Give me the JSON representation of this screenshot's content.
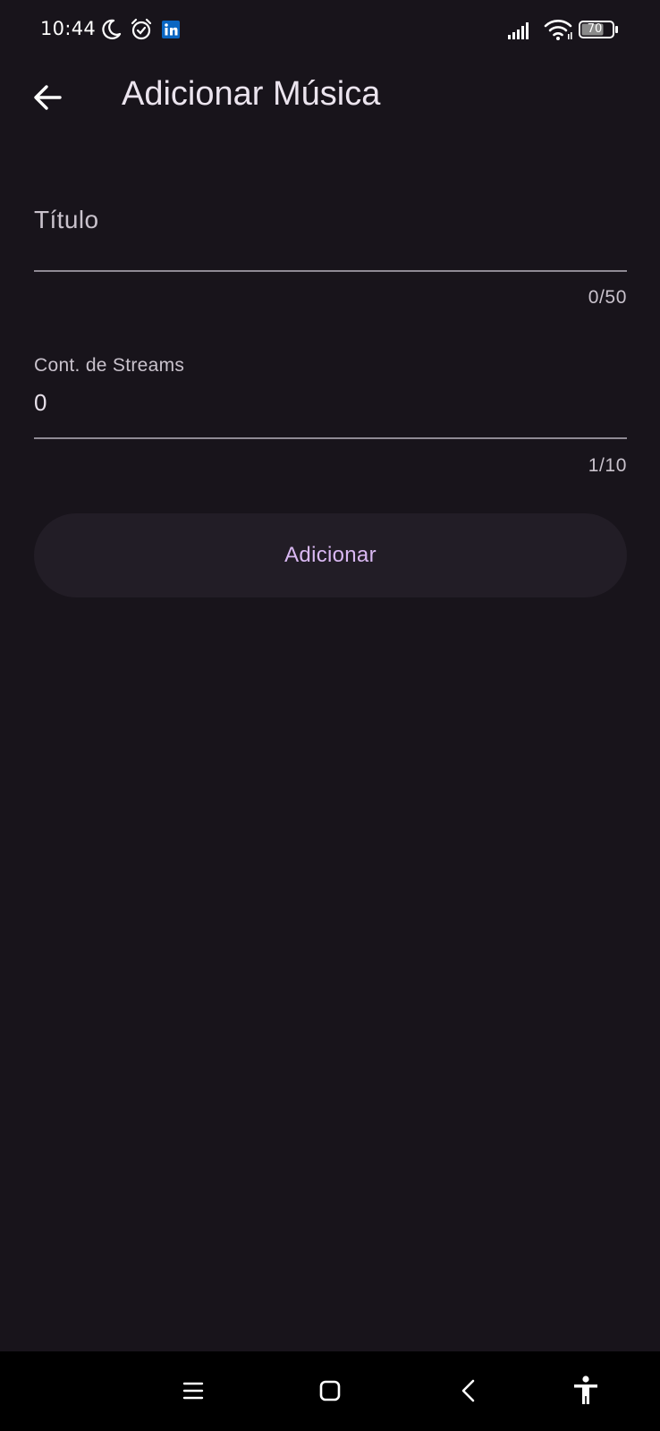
{
  "status_bar": {
    "time": "10:44",
    "battery_level": "70",
    "icons": [
      "moon-icon",
      "alarm-icon",
      "linkedin-icon",
      "signal-icon",
      "wifi-icon",
      "battery-icon"
    ]
  },
  "app_bar": {
    "title": "Adicionar Música",
    "back_icon": "arrow-left-icon"
  },
  "form": {
    "title_field": {
      "label": "Título",
      "value": "",
      "counter": "0/50"
    },
    "streams_field": {
      "label": "Cont. de Streams",
      "value": "0",
      "counter": "1/10"
    },
    "submit_label": "Adicionar"
  },
  "nav_bar": {
    "icons": [
      "menu-icon",
      "home-icon",
      "back-icon",
      "accessibility-icon"
    ]
  },
  "colors": {
    "background": "#18141b",
    "accent": "#d9b8f2",
    "button_bg": "#221d26",
    "underline": "#8f8a94",
    "nav_bg": "#000000"
  }
}
